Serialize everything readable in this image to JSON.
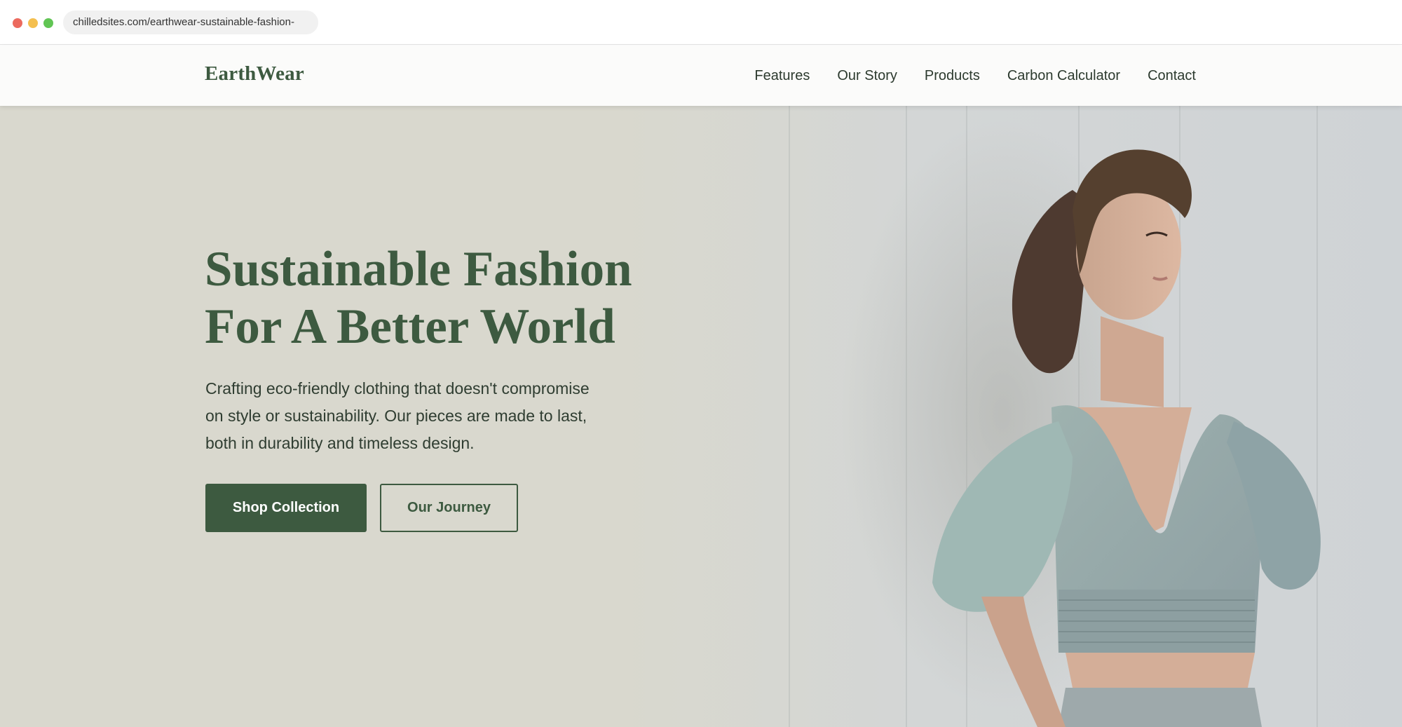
{
  "browser": {
    "url": "chilledsites.com/earthwear-sustainable-fashion-"
  },
  "nav": {
    "logo": "EarthWear",
    "links": [
      "Features",
      "Our Story",
      "Products",
      "Carbon Calculator",
      "Contact"
    ]
  },
  "hero": {
    "title_line1": "Sustainable Fashion",
    "title_line2": "For A Better World",
    "text_line1": "Crafting eco-friendly clothing that doesn't compromise",
    "text_line2": "on style or sustainability. Our pieces are made to last,",
    "text_line3": "both in durability and timeless design.",
    "primary_button": "Shop Collection",
    "secondary_button": "Our Journey"
  },
  "colors": {
    "brand_green": "#3d5a40",
    "hero_background": "#d9d8ce",
    "nav_background": "#fbfbfa"
  }
}
